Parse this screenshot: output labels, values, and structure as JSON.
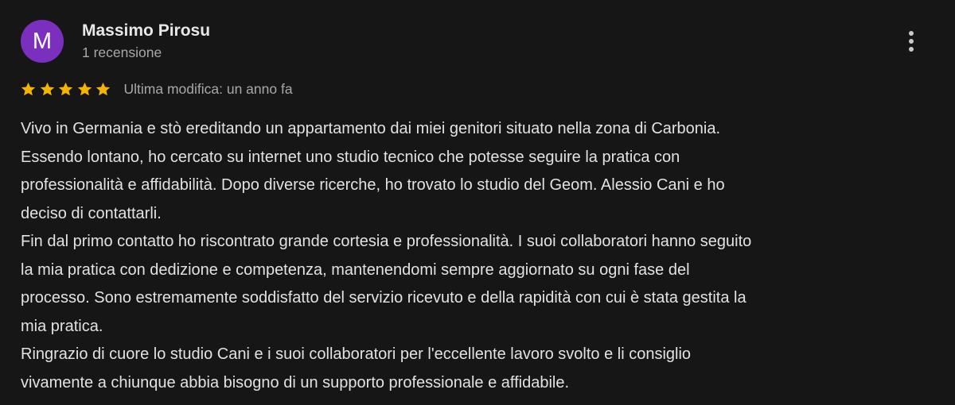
{
  "review": {
    "author_initial": "M",
    "author_name": "Massimo Pirosu",
    "review_count": "1 recensione",
    "rating": 5,
    "rating_max": 5,
    "edited_label": "Ultima modifica: un anno fa",
    "more_options_icon": "more-vert-icon",
    "text_lines": [
      "Vivo in Germania e stò ereditando un appartamento dai miei genitori situato nella zona di Carbonia.",
      "Essendo lontano, ho cercato su internet uno studio tecnico che potesse seguire la pratica con",
      "professionalità e affidabilità. Dopo diverse ricerche, ho trovato lo studio del Geom. Alessio Cani e ho",
      "deciso di contattarli.",
      "Fin dal primo contatto ho riscontrato grande cortesia e professionalità. I suoi collaboratori hanno seguito",
      "la mia pratica con dedizione e competenza, mantenendomi sempre aggiornato su ogni fase del",
      "processo. Sono estremamente soddisfatto del servizio ricevuto e della rapidità con cui è stata gestita la",
      "mia pratica.",
      "Ringrazio di cuore lo studio Cani e i suoi collaboratori per l'eccellente lavoro svolto e li consiglio",
      "vivamente a chiunque abbia bisogno di un supporto professionale e affidabile."
    ]
  },
  "colors": {
    "background": "#161616",
    "avatar": "#7b2fbf",
    "star": "#f4b400",
    "primary_text": "#e2e2e2",
    "secondary_text": "#a8a8a8"
  }
}
